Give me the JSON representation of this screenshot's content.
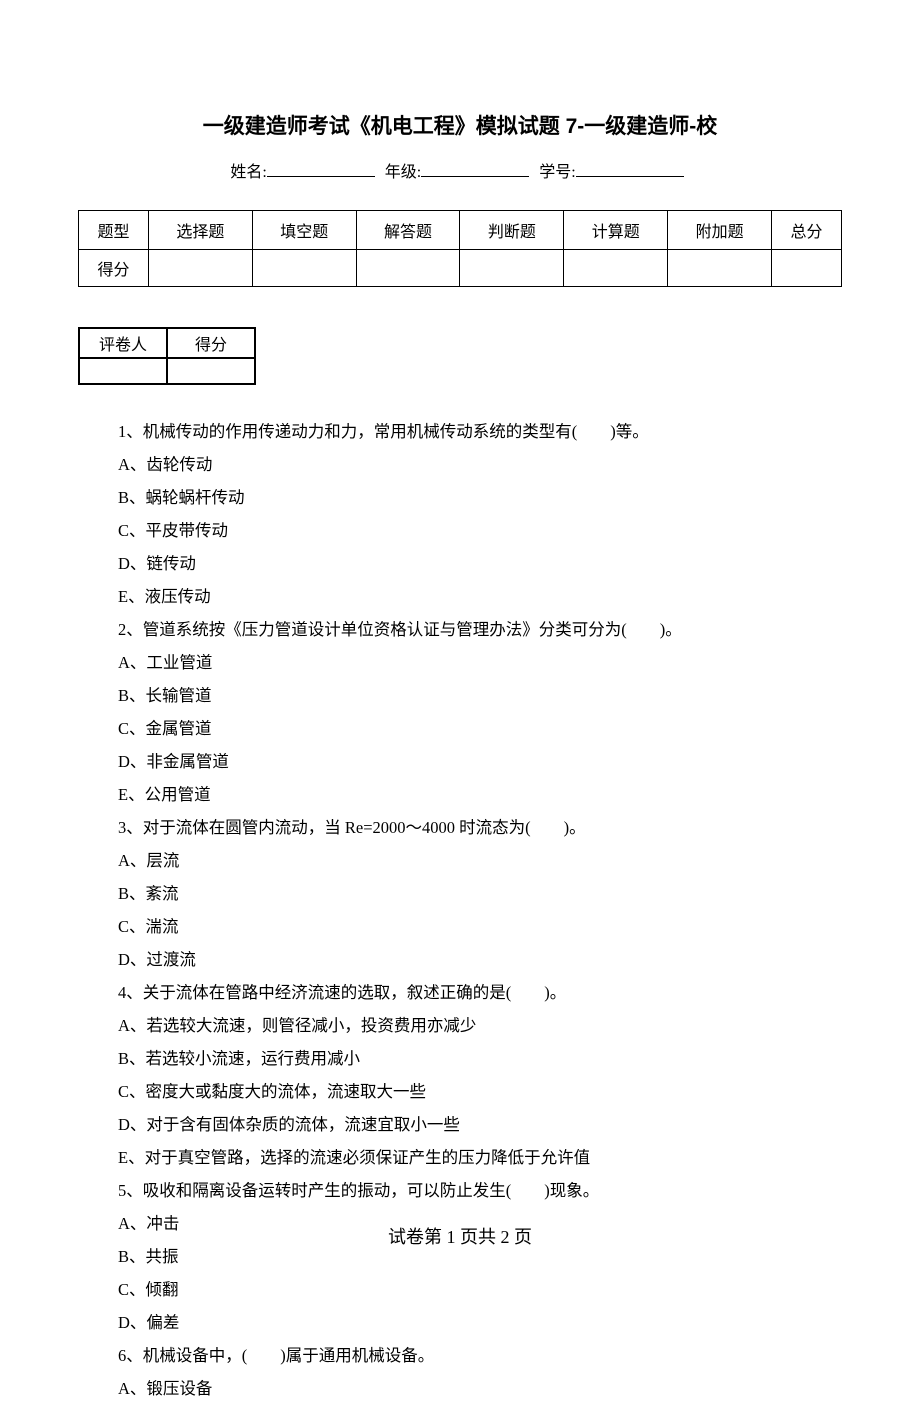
{
  "title": "一级建造师考试《机电工程》模拟试题 7-一级建造师-校",
  "info": {
    "name_label": "姓名:",
    "grade_label": "年级:",
    "id_label": "学号:"
  },
  "score_table": {
    "headers": [
      "题型",
      "选择题",
      "填空题",
      "解答题",
      "判断题",
      "计算题",
      "附加题",
      "总分"
    ],
    "row_label": "得分"
  },
  "grader_table": {
    "headers": [
      "评卷人",
      "得分"
    ]
  },
  "questions": [
    "1、机械传动的作用传递动力和力，常用机械传动系统的类型有(　　)等。",
    "A、齿轮传动",
    "B、蜗轮蜗杆传动",
    "C、平皮带传动",
    "D、链传动",
    "E、液压传动",
    "2、管道系统按《压力管道设计单位资格认证与管理办法》分类可分为(　　)。",
    "A、工业管道",
    "B、长输管道",
    "C、金属管道",
    "D、非金属管道",
    "E、公用管道",
    "3、对于流体在圆管内流动，当 Re=2000～4000 时流态为(　　)。",
    "A、层流",
    "B、紊流",
    "C、湍流",
    "D、过渡流",
    "4、关于流体在管路中经济流速的选取，叙述正确的是(　　)。",
    "A、若选较大流速，则管径减小，投资费用亦减少",
    "B、若选较小流速，运行费用减小",
    "C、密度大或黏度大的流体，流速取大一些",
    "D、对于含有固体杂质的流体，流速宜取小一些",
    "E、对于真空管路，选择的流速必须保证产生的压力降低于允许值",
    "5、吸收和隔离设备运转时产生的振动，可以防止发生(　　)现象。",
    "A、冲击",
    "B、共振",
    "C、倾翻",
    "D、偏差",
    "6、机械设备中，(　　)属于通用机械设备。",
    "A、锻压设备"
  ],
  "footer": "试卷第 1 页共 2 页"
}
